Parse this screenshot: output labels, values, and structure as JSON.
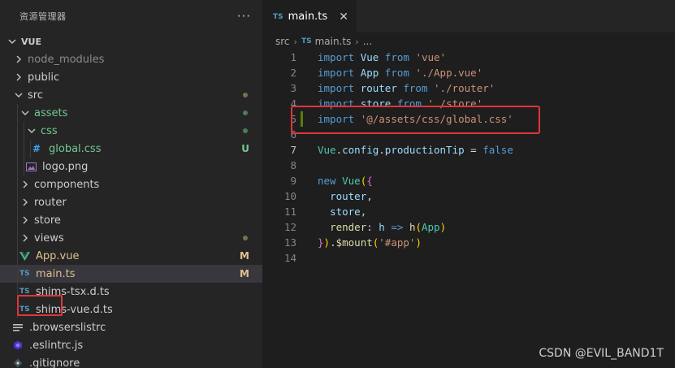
{
  "explorer": {
    "title": "资源管理器",
    "more": "···",
    "project": "VUE",
    "items": [
      {
        "label": "node_modules",
        "indent": 1,
        "kind": "folder",
        "open": false,
        "color": "#8b8b8b",
        "badge": ""
      },
      {
        "label": "public",
        "indent": 1,
        "kind": "folder",
        "open": false,
        "color": "#cccccc",
        "badge": ""
      },
      {
        "label": "src",
        "indent": 1,
        "kind": "folder",
        "open": true,
        "color": "#cccccc",
        "badge": "dot",
        "badgeColor": "#73734d"
      },
      {
        "label": "assets",
        "indent": 2,
        "kind": "folder",
        "open": true,
        "color": "#73c991",
        "badge": "dot",
        "badgeColor": "#4b7d58"
      },
      {
        "label": "css",
        "indent": 3,
        "kind": "folder",
        "open": true,
        "color": "#73c991",
        "badge": "dot",
        "badgeColor": "#4b7d58"
      },
      {
        "label": "global.css",
        "indent": 4,
        "kind": "css",
        "icon": "#",
        "iconColor": "#42a5f5",
        "color": "#73c991",
        "badge": "U",
        "badgeColor": "#73c991"
      },
      {
        "label": "logo.png",
        "indent": 3,
        "kind": "image",
        "color": "#cccccc",
        "badge": ""
      },
      {
        "label": "components",
        "indent": 2,
        "kind": "folder",
        "open": false,
        "color": "#cccccc",
        "badge": ""
      },
      {
        "label": "router",
        "indent": 2,
        "kind": "folder",
        "open": false,
        "color": "#cccccc",
        "badge": ""
      },
      {
        "label": "store",
        "indent": 2,
        "kind": "folder",
        "open": false,
        "color": "#cccccc",
        "badge": ""
      },
      {
        "label": "views",
        "indent": 2,
        "kind": "folder",
        "open": false,
        "color": "#cccccc",
        "badge": "dot",
        "badgeColor": "#73734d"
      },
      {
        "label": "App.vue",
        "indent": 2,
        "kind": "vue",
        "icon": "V",
        "iconColor": "#41b883",
        "color": "#e2c08d",
        "badge": "M",
        "badgeColor": "#e2c08d"
      },
      {
        "label": "main.ts",
        "indent": 2,
        "kind": "ts",
        "icon": "TS",
        "iconColor": "#519aba",
        "color": "#e2c08d",
        "badge": "M",
        "badgeColor": "#e2c08d",
        "selected": true
      },
      {
        "label": "shims-tsx.d.ts",
        "indent": 2,
        "kind": "ts",
        "icon": "TS",
        "iconColor": "#519aba",
        "color": "#cccccc",
        "badge": ""
      },
      {
        "label": "shims-vue.d.ts",
        "indent": 2,
        "kind": "ts",
        "icon": "TS",
        "iconColor": "#519aba",
        "color": "#cccccc",
        "badge": ""
      },
      {
        "label": ".browserslistrc",
        "indent": 1,
        "kind": "lines",
        "color": "#cccccc",
        "badge": ""
      },
      {
        "label": ".eslintrc.js",
        "indent": 1,
        "kind": "eslint",
        "color": "#cccccc",
        "badge": ""
      },
      {
        "label": ".gitignore",
        "indent": 1,
        "kind": "git",
        "color": "#cccccc",
        "badge": ""
      }
    ]
  },
  "editor": {
    "tab": {
      "icon": "TS",
      "label": "main.ts",
      "close": "✕"
    },
    "breadcrumb": {
      "folder": "src",
      "icon": "TS",
      "file": "main.ts",
      "rest": "..."
    },
    "lines": [
      {
        "n": "1",
        "tokens": [
          [
            "kw",
            "import"
          ],
          [
            "pn",
            " "
          ],
          [
            "id",
            "Vue"
          ],
          [
            "pn",
            " "
          ],
          [
            "kw",
            "from"
          ],
          [
            "pn",
            " "
          ],
          [
            "str",
            "'vue'"
          ]
        ]
      },
      {
        "n": "2",
        "tokens": [
          [
            "kw",
            "import"
          ],
          [
            "pn",
            " "
          ],
          [
            "id",
            "App"
          ],
          [
            "pn",
            " "
          ],
          [
            "kw",
            "from"
          ],
          [
            "pn",
            " "
          ],
          [
            "str",
            "'./App.vue'"
          ]
        ]
      },
      {
        "n": "3",
        "tokens": [
          [
            "kw",
            "import"
          ],
          [
            "pn",
            " "
          ],
          [
            "id",
            "router"
          ],
          [
            "pn",
            " "
          ],
          [
            "kw",
            "from"
          ],
          [
            "pn",
            " "
          ],
          [
            "str",
            "'./router'"
          ]
        ]
      },
      {
        "n": "4",
        "tokens": [
          [
            "kw",
            "import"
          ],
          [
            "pn",
            " "
          ],
          [
            "id",
            "store"
          ],
          [
            "pn",
            " "
          ],
          [
            "kw",
            "from"
          ],
          [
            "pn",
            " "
          ],
          [
            "str",
            "'./store'"
          ]
        ]
      },
      {
        "n": "5",
        "modified": true,
        "tokens": [
          [
            "kw",
            "import"
          ],
          [
            "pn",
            " "
          ],
          [
            "str",
            "'@/assets/css/global.css'"
          ]
        ]
      },
      {
        "n": "6",
        "tokens": []
      },
      {
        "n": "7",
        "active": true,
        "tokens": [
          [
            "ty",
            "Vue"
          ],
          [
            "pn",
            "."
          ],
          [
            "id",
            "config"
          ],
          [
            "pn",
            "."
          ],
          [
            "id",
            "productionTip"
          ],
          [
            "pn",
            " = "
          ],
          [
            "kw",
            "false"
          ]
        ]
      },
      {
        "n": "8",
        "tokens": []
      },
      {
        "n": "9",
        "tokens": [
          [
            "kw",
            "new"
          ],
          [
            "pn",
            " "
          ],
          [
            "ty",
            "Vue"
          ],
          [
            "br",
            "("
          ],
          [
            "br2",
            "{"
          ]
        ]
      },
      {
        "n": "10",
        "tokens": [
          [
            "pn",
            "  "
          ],
          [
            "id",
            "router"
          ],
          [
            "pn",
            ","
          ]
        ]
      },
      {
        "n": "11",
        "tokens": [
          [
            "pn",
            "  "
          ],
          [
            "id",
            "store"
          ],
          [
            "pn",
            ","
          ]
        ]
      },
      {
        "n": "12",
        "tokens": [
          [
            "pn",
            "  "
          ],
          [
            "fn",
            "render"
          ],
          [
            "pn",
            ": "
          ],
          [
            "id",
            "h"
          ],
          [
            "pn",
            " "
          ],
          [
            "kw",
            "=>"
          ],
          [
            "pn",
            " "
          ],
          [
            "fn",
            "h"
          ],
          [
            "br",
            "("
          ],
          [
            "ty",
            "App"
          ],
          [
            "br",
            ")"
          ]
        ]
      },
      {
        "n": "13",
        "tokens": [
          [
            "br2",
            "}"
          ],
          [
            "br",
            ")"
          ],
          [
            "pn",
            "."
          ],
          [
            "fn",
            "$mount"
          ],
          [
            "br",
            "("
          ],
          [
            "str",
            "'#app'"
          ],
          [
            "br",
            ")"
          ]
        ]
      },
      {
        "n": "14",
        "tokens": []
      }
    ]
  },
  "watermark": "CSDN @EVIL_BAND1T",
  "colors": {
    "highlight": "#e0353c",
    "sidebar": "#252526",
    "editor": "#1e1e1e"
  }
}
